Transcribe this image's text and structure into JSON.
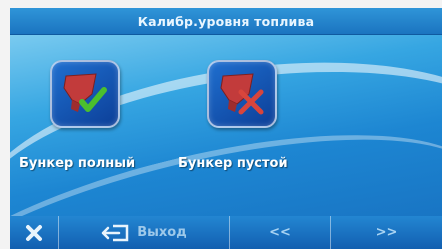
{
  "header": {
    "title": "Калибр.уровня топлива"
  },
  "tiles": [
    {
      "label": "Бункер полный",
      "icon": "hopper-check-icon"
    },
    {
      "label": "Бункер пустой",
      "icon": "hopper-cross-icon"
    }
  ],
  "toolbar": {
    "close_icon": "close-icon",
    "exit_label": "Выход",
    "prev_label": "<<",
    "next_label": ">>"
  },
  "colors": {
    "accent": "#1d86d2",
    "check": "#4bbf2e",
    "cross": "#d8453c",
    "hopper": "#c23b3b"
  }
}
